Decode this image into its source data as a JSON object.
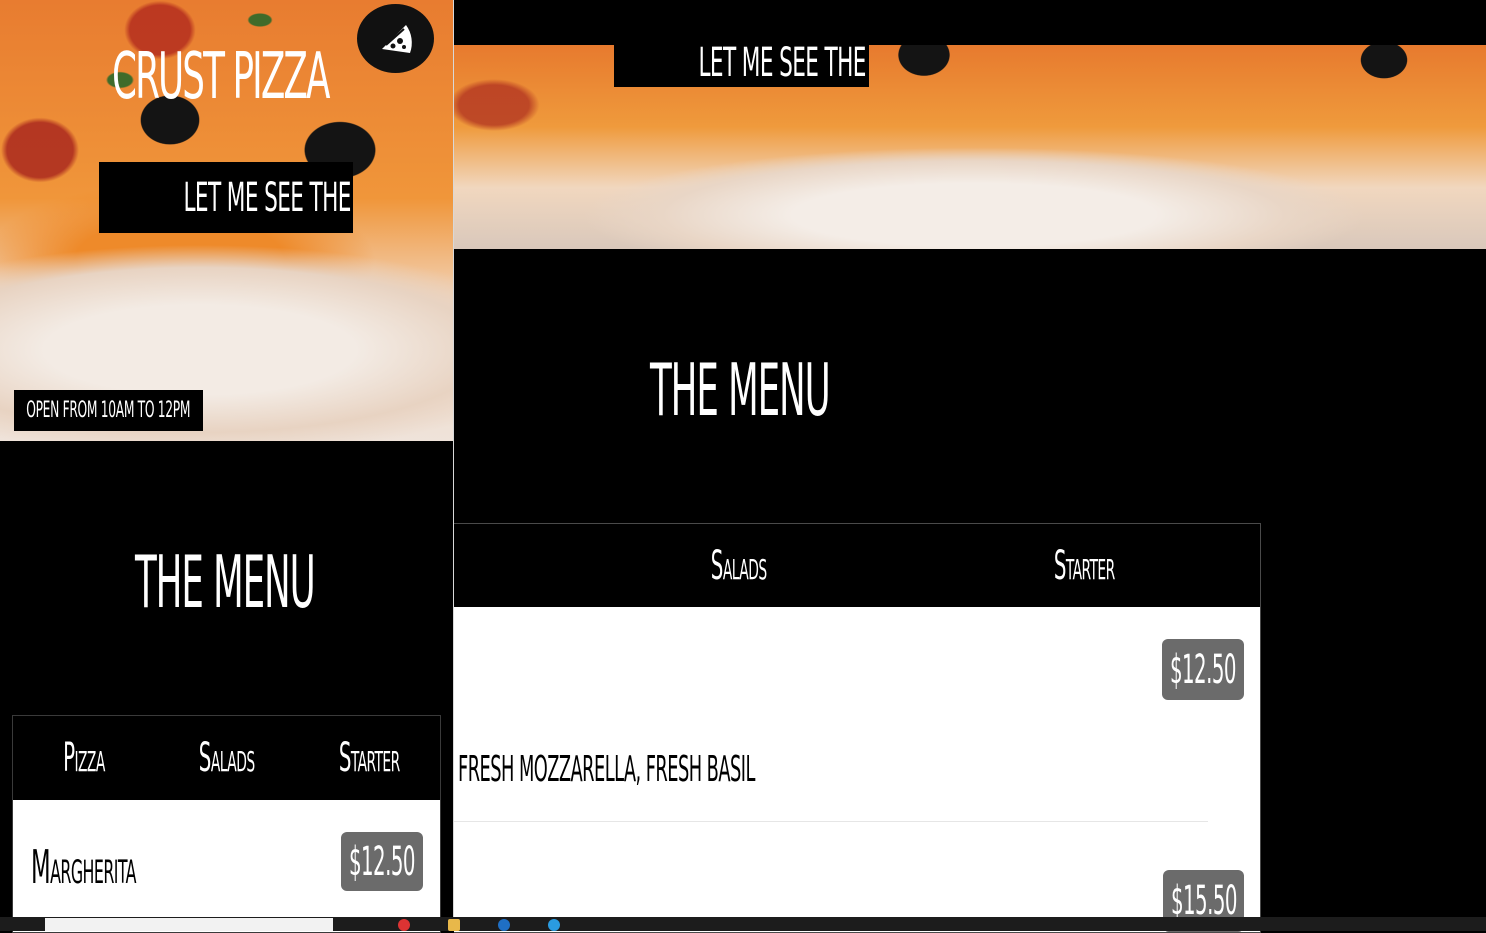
{
  "brand": {
    "name": "CRUST PIZZA"
  },
  "hero": {
    "menu_button_label": "LET ME SEE THE MENU",
    "hours_text": "OPEN FROM 10AM TO 12PM"
  },
  "menu_section": {
    "heading": "THE MENU",
    "tabs": [
      "Pizza",
      "Salads",
      "Starter"
    ],
    "items": [
      {
        "name": "Margherita",
        "price": "$12.50",
        "description": "FRESH MOZZARELLA, FRESH BASIL"
      },
      {
        "price": "$15.50"
      }
    ]
  },
  "colors": {
    "background": "#000000",
    "price_badge": "#6b6b6b",
    "panel_body": "#ffffff"
  },
  "icons": {
    "logo": "pizza-slice-icon"
  }
}
